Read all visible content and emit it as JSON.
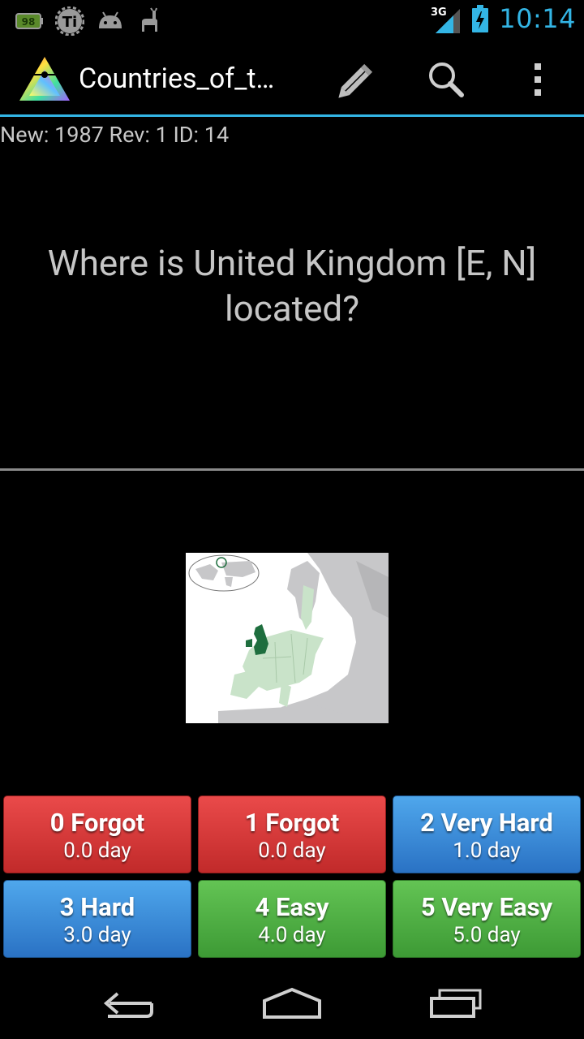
{
  "status_bar": {
    "battery_badge": "98",
    "network": "3G",
    "time": "10:14",
    "accent_color": "#33b5e5"
  },
  "action_bar": {
    "title": "Countries_of_t…",
    "icons": [
      "app-logo",
      "pencil-icon",
      "search-icon",
      "overflow-menu-icon"
    ]
  },
  "card": {
    "stats": "New: 1987 Rev: 1 ID: 14",
    "question_line1": "Where is United Kingdom [E, N]",
    "question_line2": "located?"
  },
  "grades": [
    {
      "label": "0 Forgot",
      "interval": "0.0 day",
      "color": "#d63a3a"
    },
    {
      "label": "1 Forgot",
      "interval": "0.0 day",
      "color": "#d63a3a"
    },
    {
      "label": "2 Very Hard",
      "interval": "1.0 day",
      "color": "#3b8cd9"
    },
    {
      "label": "3 Hard",
      "interval": "3.0 day",
      "color": "#3b8cd9"
    },
    {
      "label": "4 Easy",
      "interval": "4.0 day",
      "color": "#4fae45"
    },
    {
      "label": "5 Very Easy",
      "interval": "5.0 day",
      "color": "#4fae45"
    }
  ],
  "nav_bar": {
    "icons": [
      "back-icon",
      "home-icon",
      "recent-apps-icon"
    ]
  }
}
